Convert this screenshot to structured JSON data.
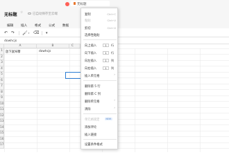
{
  "tab": {
    "title": "无标题"
  },
  "document": {
    "title": "无标题",
    "save_status": "已自动保存至云端"
  },
  "menubar": {
    "items": [
      "编辑",
      "插入",
      "格式",
      "公式",
      "数据"
    ]
  },
  "formula_bar": {
    "value": "dowhcjs"
  },
  "grid": {
    "columns": [
      "A",
      "B",
      "C"
    ],
    "rows": [
      "1",
      "2",
      "3",
      "4",
      "5",
      "6",
      "7",
      "8",
      "9",
      "10",
      "11",
      "12",
      "13",
      "14",
      "15",
      "16",
      "17"
    ],
    "cells": {
      "A1": "放下就咔嚓",
      "B1": "dowhcjs"
    }
  },
  "context_menu": {
    "copy": "复制",
    "copy_shortcut": "Ctrl+C",
    "paste": "粘贴",
    "paste_shortcut": "Ctrl+V",
    "cut": "剪切",
    "cut_shortcut": "Ctrl+X",
    "paste_special": "选择性粘贴",
    "insert_row_above": "向上插入",
    "insert_row_below": "向下插入",
    "insert_col_left": "向左插入",
    "insert_col_right": "向右插入",
    "count": "1",
    "unit_row": "行",
    "unit_col": "列",
    "insert_cells": "插入单元格",
    "delete_row": "删除第 5 行",
    "delete_col": "删除第 C 列",
    "delete_cells": "删除单元格",
    "clear": "清除",
    "cell_lock": "单元格锁定",
    "new_badge": "NEW",
    "add_comment": "添加评论",
    "insert_link": "插入链接",
    "cond_format": "设置条件格式",
    "cond_format2": "条件格式"
  },
  "icons": {
    "undo": "undo-icon",
    "redo": "redo-icon",
    "paint": "paint-format-icon",
    "clear": "eraser-icon"
  }
}
